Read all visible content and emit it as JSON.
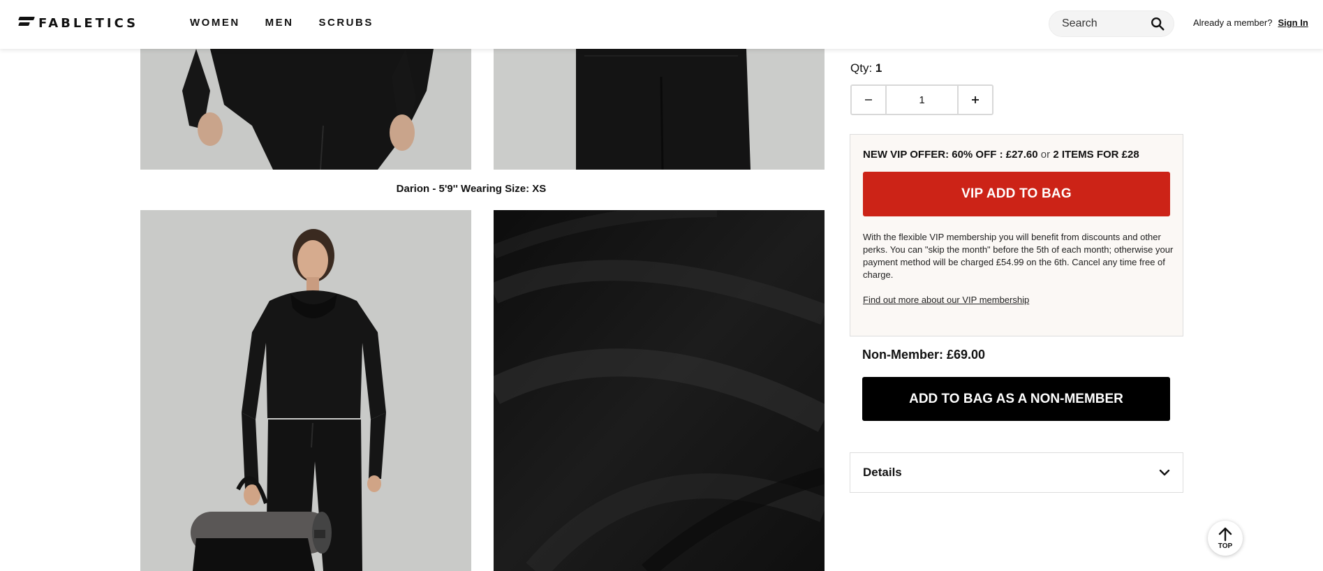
{
  "header": {
    "logo_text": "FABLETICS",
    "nav": [
      "WOMEN",
      "MEN",
      "SCRUBS"
    ],
    "search_placeholder": "Search",
    "member_prompt": "Already a member?",
    "sign_in": "Sign In"
  },
  "gallery": {
    "caption": "Darion - 5'9'' Wearing Size: XS",
    "background_color": "#c9cac8",
    "garment_color": "#151515"
  },
  "quantity": {
    "label": "Qty:",
    "value": "1",
    "input_value": "1",
    "minus_icon": "minus-icon",
    "plus_icon": "plus-icon"
  },
  "vip": {
    "offer_main": "NEW VIP OFFER: 60% OFF : £27.60",
    "offer_or": "or",
    "offer_alt": "2 ITEMS FOR £28",
    "button": "VIP ADD TO BAG",
    "description": "With the flexible VIP membership you will benefit from discounts and other perks. You can \"skip the month\" before the 5th of each month; otherwise your payment method will be charged £54.99 on the 6th. Cancel any time free of charge.",
    "link": "Find out more about our VIP membership",
    "accent_color": "#cc2317"
  },
  "nonmember": {
    "label": "Non-Member:",
    "price": "£69.00",
    "button": "ADD TO BAG AS A NON-MEMBER"
  },
  "details": {
    "label": "Details"
  },
  "back_to_top": {
    "label": "TOP"
  }
}
